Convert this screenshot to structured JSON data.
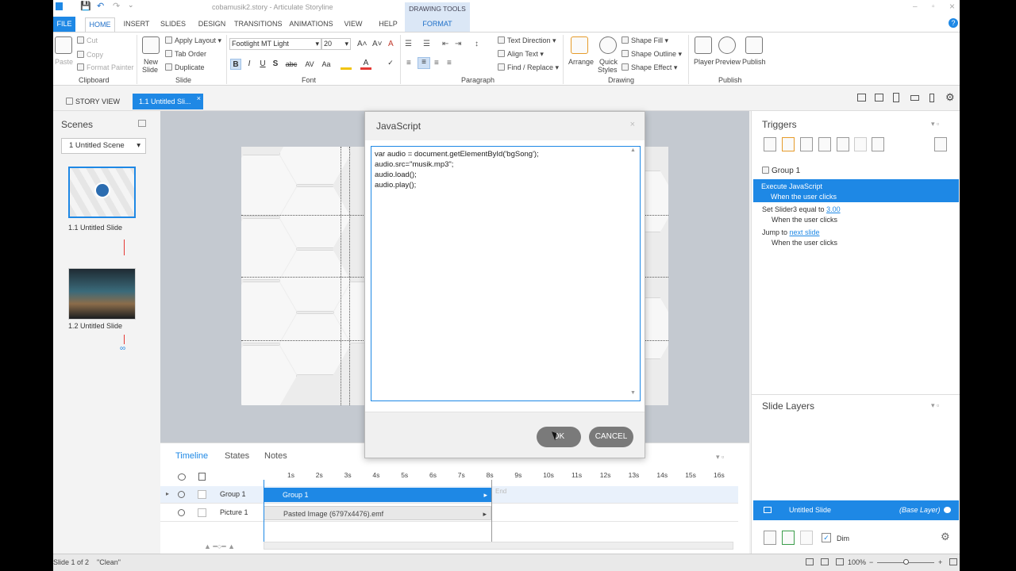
{
  "window": {
    "title": "cobamusik2.story - Articulate Storyline",
    "minimize": "–",
    "restore": "▫",
    "close": "×",
    "help": "?"
  },
  "quick_access": {
    "save": "💾",
    "undo": "↶",
    "redo": "↷",
    "customize": "⌄"
  },
  "ribbon_tabs": [
    "FILE",
    "HOME",
    "INSERT",
    "SLIDES",
    "DESIGN",
    "TRANSITIONS",
    "ANIMATIONS",
    "VIEW",
    "HELP"
  ],
  "context_tab": {
    "group": "DRAWING TOOLS",
    "tab": "FORMAT"
  },
  "clipboard": {
    "paste": "Paste",
    "cut": "Cut",
    "copy": "Copy",
    "format_painter": "Format Painter",
    "group": "Clipboard"
  },
  "slide_group": {
    "new_slide": "New",
    "new_slide2": "Slide",
    "apply_layout": "Apply Layout",
    "tab_order": "Tab Order",
    "duplicate": "Duplicate",
    "group": "Slide"
  },
  "font": {
    "family": "Footlight MT Light",
    "size": "20",
    "group": "Font",
    "bold": "B",
    "italic": "I",
    "underline": "U",
    "shadow": "S",
    "strike": "abc",
    "grow": "A˄",
    "shrink": "A˅",
    "spacing": "AV",
    "case": "Aa",
    "clear": "A"
  },
  "paragraph": {
    "text_direction": "Text Direction",
    "align_text": "Align Text",
    "find_replace": "Find / Replace",
    "group": "Paragraph"
  },
  "drawing": {
    "arrange": "Arrange",
    "quick_styles": "Quick",
    "quick_styles2": "Styles",
    "shape_fill": "Shape Fill",
    "shape_outline": "Shape Outline",
    "shape_effect": "Shape Effect",
    "group": "Drawing"
  },
  "publish": {
    "player": "Player",
    "preview": "Preview",
    "publish": "Publish",
    "group": "Publish"
  },
  "doc_tabs": {
    "story_view": "STORY VIEW",
    "slide": "1.1 Untitled Sli...",
    "close": "×"
  },
  "scenes": {
    "title": "Scenes",
    "selected_scene": "1 Untitled Scene",
    "slides": [
      {
        "label": "1.1 Untitled Slide"
      },
      {
        "label": "1.2 Untitled Slide"
      }
    ]
  },
  "timeline": {
    "tabs": [
      "Timeline",
      "States",
      "Notes"
    ],
    "ruler": [
      "1s",
      "2s",
      "3s",
      "4s",
      "5s",
      "6s",
      "7s",
      "8s",
      "9s",
      "10s",
      "11s",
      "12s",
      "13s",
      "14s",
      "15s",
      "16s"
    ],
    "rows": [
      {
        "name": "Group 1",
        "bar": "Group 1"
      },
      {
        "name": "Picture 1",
        "bar": "Pasted Image (6797x4476).emf"
      }
    ],
    "end_label": "End"
  },
  "triggers": {
    "title": "Triggers",
    "object": "Group 1",
    "items": [
      {
        "action": "Execute JavaScript",
        "when": "When the user clicks"
      },
      {
        "action_prefix": "Set Slider3 equal to ",
        "action_link": "3.00",
        "when": "When the user clicks"
      },
      {
        "action_prefix": "Jump to ",
        "action_link": "next slide",
        "when": "When the user clicks"
      }
    ]
  },
  "slide_layers": {
    "title": "Slide Layers",
    "base_name": "Untitled Slide",
    "base_tag": "(Base Layer)",
    "dim": "Dim"
  },
  "dialog": {
    "title": "JavaScript",
    "code": "var audio = document.getElementById('bgSong');\naudio.src=\"musik.mp3\";\naudio.load();\naudio.play();",
    "ok": "OK",
    "cancel": "CANCEL"
  },
  "status": {
    "slide": "Slide 1 of 2",
    "theme": "\"Clean\"",
    "zoom": "100%"
  },
  "colors": {
    "accent": "#1e88e5",
    "trigger_link": "#1e88e5"
  }
}
